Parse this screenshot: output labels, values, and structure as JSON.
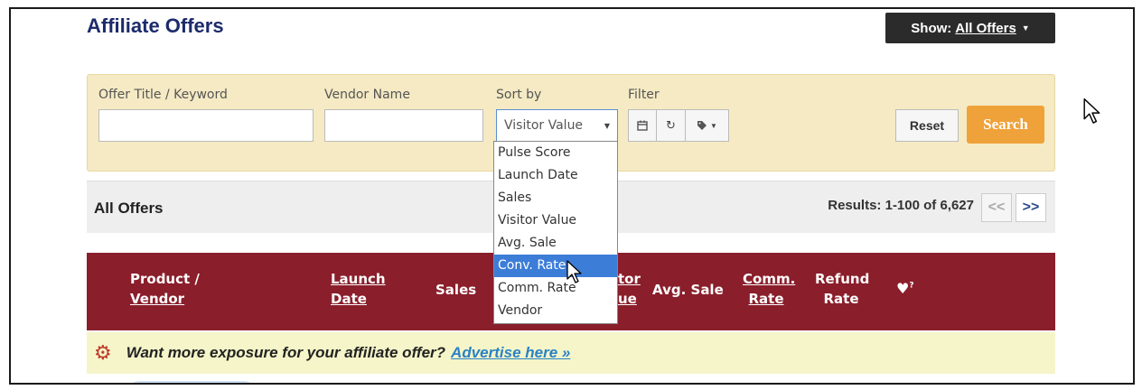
{
  "page": {
    "title": "Affiliate Offers"
  },
  "show_filter": {
    "label": "Show:",
    "value": "All Offers"
  },
  "search": {
    "keyword_label": "Offer Title / Keyword",
    "keyword_value": "",
    "vendor_label": "Vendor Name",
    "vendor_value": "",
    "sort_label": "Sort by",
    "sort_value": "Visitor Value",
    "filter_label": "Filter",
    "reset_label": "Reset",
    "search_label": "Search"
  },
  "sort_options": [
    "Pulse Score",
    "Launch Date",
    "Sales",
    "Visitor Value",
    "Avg. Sale",
    "Conv. Rate",
    "Comm. Rate",
    "Vendor"
  ],
  "sort_highlighted": "Conv. Rate",
  "results": {
    "title": "All Offers",
    "count_text": "Results: 1-100 of 6,627",
    "prev": "<<",
    "next": ">>"
  },
  "columns": {
    "product_1": "Product /",
    "product_2": "Vendor",
    "launch_1": "Launch",
    "launch_2": "Date",
    "sales": "Sales",
    "visitor_1": "tor",
    "visitor_2": "ue",
    "avg_sale": "Avg. Sale",
    "comm_1": "Comm.",
    "comm_2": "Rate",
    "refund_1": "Refund",
    "refund_2": "Rate",
    "heart_sup": "?"
  },
  "ad": {
    "text": "Want more exposure for your affiliate offer?",
    "link": "Advertise here »"
  },
  "icons": {
    "calendar": "calendar-icon",
    "refresh": "refresh-icon",
    "tag": "tag-icon",
    "heart": "heart-icon",
    "gear": "gear-icon",
    "cursor": "pointer-cursor-icon"
  },
  "colors": {
    "title": "#1c2b6b",
    "header_bg": "#8a1e2b",
    "search_button": "#f0a23a",
    "panel_bg": "#f5eac3",
    "selected_option": "#3c7dd8",
    "ad_bg": "#f5f5c9",
    "link": "#2a82c6"
  }
}
